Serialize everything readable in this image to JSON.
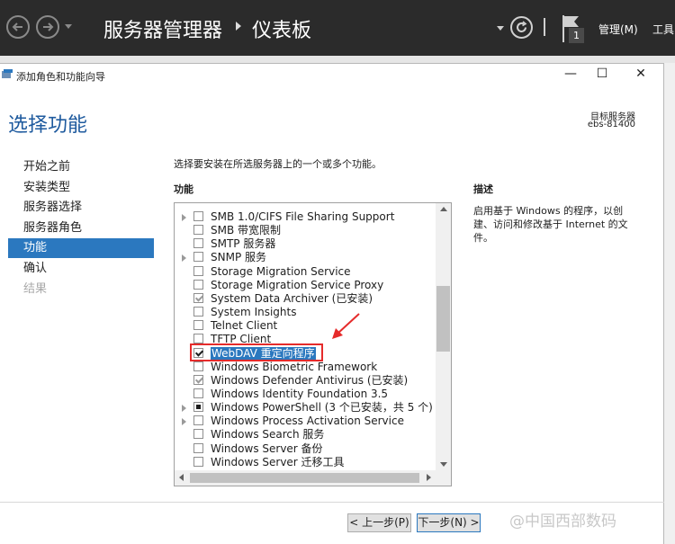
{
  "server_manager": {
    "title": "服务器管理器",
    "page": "仪表板",
    "menu_manage": "管理(M)",
    "menu_tools": "工具",
    "notification_count": "1",
    "icons": [
      "back-arrow-icon",
      "forward-arrow-icon",
      "refresh-icon",
      "flag-icon"
    ]
  },
  "wizard": {
    "window_title": "添加角色和功能向导",
    "window_controls": {
      "minimize": "—",
      "maximize": "☐",
      "close": "✕"
    },
    "heading": "选择功能",
    "destination_label": "目标服务器",
    "destination_name": "ebs-81400",
    "steps": [
      {
        "label": "开始之前",
        "state": "normal"
      },
      {
        "label": "安装类型",
        "state": "normal"
      },
      {
        "label": "服务器选择",
        "state": "normal"
      },
      {
        "label": "服务器角色",
        "state": "normal"
      },
      {
        "label": "功能",
        "state": "active"
      },
      {
        "label": "确认",
        "state": "normal"
      },
      {
        "label": "结果",
        "state": "disabled"
      }
    ],
    "instruction": "选择要安装在所选服务器上的一个或多个功能。",
    "features_heading": "功能",
    "features": [
      {
        "label": "SMB 1.0/CIFS File Sharing Support",
        "expandable": true,
        "state": "unchecked"
      },
      {
        "label": "SMB 带宽限制",
        "expandable": false,
        "state": "unchecked"
      },
      {
        "label": "SMTP 服务器",
        "expandable": false,
        "state": "unchecked"
      },
      {
        "label": "SNMP 服务",
        "expandable": true,
        "state": "unchecked"
      },
      {
        "label": "Storage Migration Service",
        "expandable": false,
        "state": "unchecked"
      },
      {
        "label": "Storage Migration Service Proxy",
        "expandable": false,
        "state": "unchecked"
      },
      {
        "label": "System Data Archiver (已安装)",
        "expandable": false,
        "state": "installed"
      },
      {
        "label": "System Insights",
        "expandable": false,
        "state": "unchecked"
      },
      {
        "label": "Telnet Client",
        "expandable": false,
        "state": "unchecked"
      },
      {
        "label": "TFTP Client",
        "expandable": false,
        "state": "unchecked"
      },
      {
        "label": "WebDAV 重定向程序",
        "expandable": false,
        "state": "checked",
        "selected": true
      },
      {
        "label": "Windows Biometric Framework",
        "expandable": false,
        "state": "unchecked"
      },
      {
        "label": "Windows Defender Antivirus (已安装)",
        "expandable": false,
        "state": "installed"
      },
      {
        "label": "Windows Identity Foundation 3.5",
        "expandable": false,
        "state": "unchecked"
      },
      {
        "label": "Windows PowerShell (3 个已安装，共 5 个)",
        "expandable": true,
        "state": "partial"
      },
      {
        "label": "Windows Process Activation Service",
        "expandable": true,
        "state": "unchecked"
      },
      {
        "label": "Windows Search 服务",
        "expandable": false,
        "state": "unchecked"
      },
      {
        "label": "Windows Server 备份",
        "expandable": false,
        "state": "unchecked"
      },
      {
        "label": "Windows Server 迁移工具",
        "expandable": false,
        "state": "unchecked"
      }
    ],
    "description_heading": "描述",
    "description": "启用基于 Windows 的程序，以创建、访问和修改基于 Internet 的文件。",
    "buttons": {
      "previous": "< 上一步(P)",
      "next": "下一步(N) >"
    }
  },
  "watermark": "@中国西部数码",
  "colors": {
    "accent": "#2b78bf",
    "heading": "#1e5a9e",
    "annotation": "#e52b2b",
    "topbar": "#2b2b2b"
  }
}
